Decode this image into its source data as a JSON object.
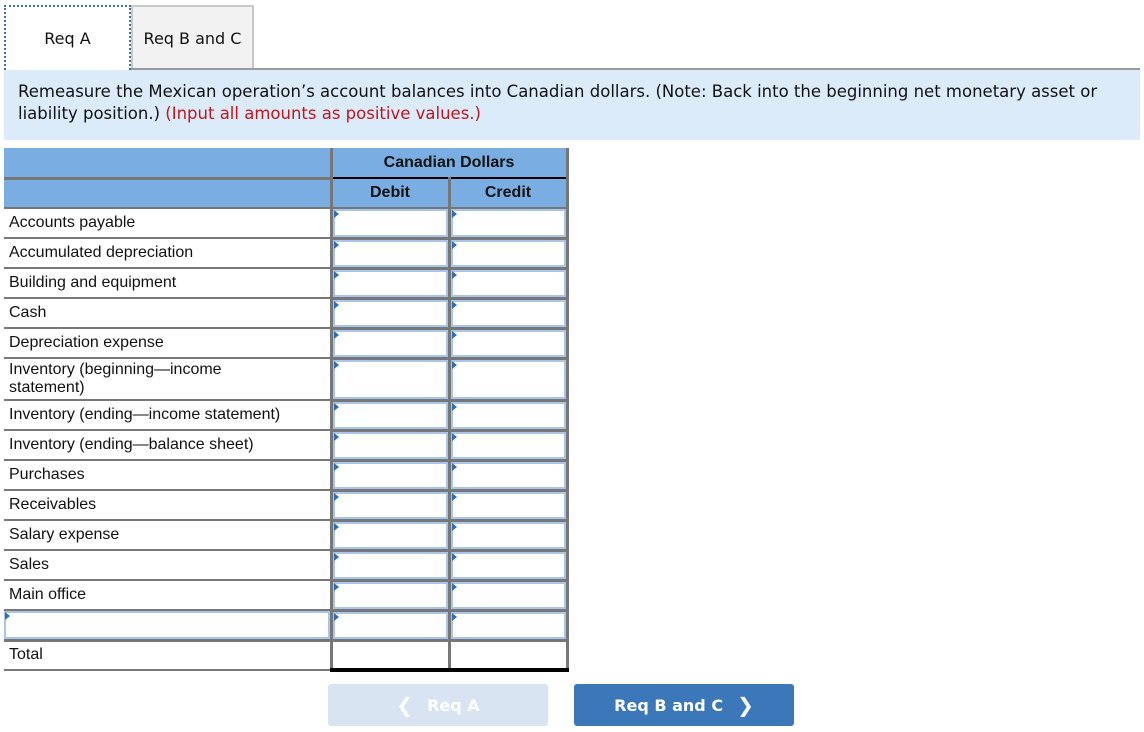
{
  "tabs": [
    {
      "label": "Req A",
      "active": true
    },
    {
      "label": "Req B and C",
      "active": false
    }
  ],
  "instructions": {
    "text": "Remeasure the Mexican operation’s account balances into Canadian dollars. (Note: Back into the beginning net monetary asset or liability position.)",
    "note": "(Input all amounts as positive values.)"
  },
  "table": {
    "group_header": "Canadian Dollars",
    "columns": [
      "Debit",
      "Credit"
    ],
    "rows": [
      {
        "label": "Accounts payable",
        "debit": "",
        "credit": ""
      },
      {
        "label": "Accumulated depreciation",
        "debit": "",
        "credit": ""
      },
      {
        "label": "Building and equipment",
        "debit": "",
        "credit": ""
      },
      {
        "label": "Cash",
        "debit": "",
        "credit": ""
      },
      {
        "label": "Depreciation expense",
        "debit": "",
        "credit": ""
      },
      {
        "label": "Inventory (beginning—income statement)",
        "debit": "",
        "credit": ""
      },
      {
        "label": "Inventory (ending—income statement)",
        "debit": "",
        "credit": ""
      },
      {
        "label": "Inventory (ending—balance sheet)",
        "debit": "",
        "credit": ""
      },
      {
        "label": "Purchases",
        "debit": "",
        "credit": ""
      },
      {
        "label": "Receivables",
        "debit": "",
        "credit": ""
      },
      {
        "label": "Salary expense",
        "debit": "",
        "credit": ""
      },
      {
        "label": "Sales",
        "debit": "",
        "credit": ""
      },
      {
        "label": "Main office",
        "debit": "",
        "credit": ""
      }
    ],
    "blank_row": {
      "label": "",
      "debit": "",
      "credit": ""
    },
    "total_row": {
      "label": "Total",
      "debit": "",
      "credit": ""
    }
  },
  "nav": {
    "prev_label": "Req A",
    "next_label": "Req B and C"
  }
}
